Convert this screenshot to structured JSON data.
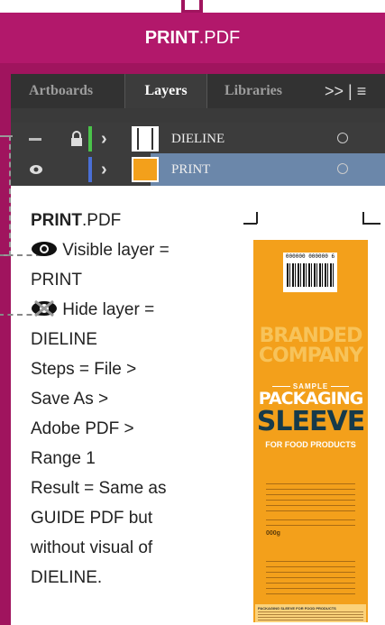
{
  "banner": {
    "bold": "PRINT",
    "rest": ".PDF"
  },
  "panel": {
    "tabs": [
      "Artboards",
      "Layers",
      "Libraries"
    ],
    "menu_label": ">>  |  ≡",
    "layers": [
      {
        "name": "DIELINE",
        "visible": false,
        "locked": true,
        "color": "#4ac34a"
      },
      {
        "name": "PRINT",
        "visible": true,
        "locked": false,
        "color": "#4a6fd6"
      }
    ]
  },
  "description": {
    "file_bold": "PRINT",
    "file_rest": ".PDF",
    "visible_text": "Visible layer =",
    "visible_value": "PRINT",
    "hide_text": "Hide layer =",
    "hide_value": "DIELINE",
    "steps": [
      "Steps = File >",
      "Save As >",
      "Adobe PDF >",
      "Range 1"
    ],
    "result": [
      "Result = Same as",
      "GUIDE PDF but",
      "without visual of",
      "DIELINE."
    ]
  },
  "sleeve": {
    "barcode_number": "000000 000000 6",
    "brand_line1": "BRANDED",
    "brand_line2": "COMPANY",
    "sample_label": "SAMPLE",
    "title_line1": "PACKAGING",
    "title_line2": "SLEEVE",
    "subtitle": "FOR FOOD PRODUCTS",
    "weight": "000g",
    "footer_heading": "PACKAGING SLEEVE FOR FOOD PRODUCTS",
    "colors": {
      "background": "#f3a01b",
      "title_dark": "#173a4a",
      "brand_light": "#f7c35a"
    }
  }
}
